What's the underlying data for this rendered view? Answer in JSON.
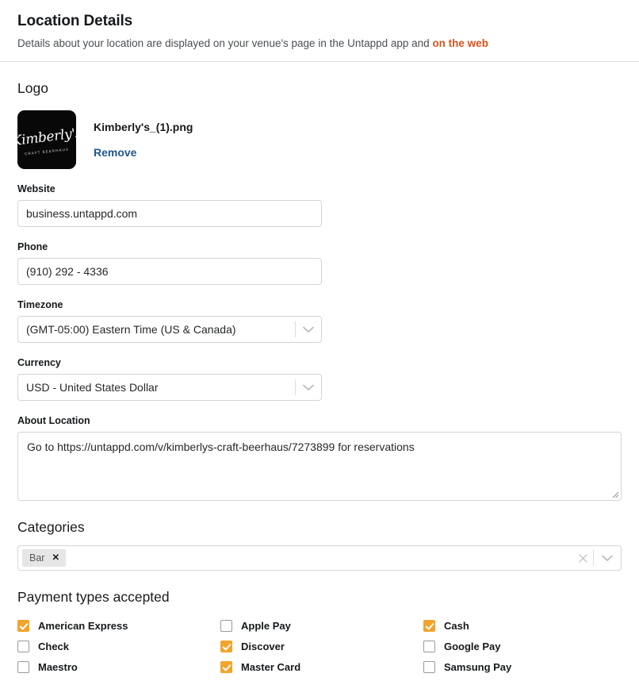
{
  "header": {
    "title": "Location Details",
    "subtitle_prefix": "Details about your location are displayed on your venue's page in the Untappd app and ",
    "link_text": "on the web"
  },
  "logo": {
    "heading": "Logo",
    "mark_script": "Kimberly's",
    "mark_sub": "CRAFT BEERHAUS",
    "filename": "Kimberly's_(1).png",
    "remove_label": "Remove"
  },
  "fields": {
    "website": {
      "label": "Website",
      "value": "business.untappd.com",
      "placeholder": "Website"
    },
    "phone": {
      "label": "Phone",
      "value": "(910) 292 - 4336",
      "placeholder": "Phone"
    },
    "timezone": {
      "label": "Timezone",
      "value": "(GMT-05:00) Eastern Time (US & Canada)"
    },
    "currency": {
      "label": "Currency",
      "value": "USD - United States Dollar"
    },
    "about": {
      "label": "About Location",
      "value": "Go to https://untappd.com/v/kimberlys-craft-beerhaus/7273899 for reservations",
      "placeholder": "About Location"
    }
  },
  "categories": {
    "heading": "Categories",
    "tags": [
      {
        "label": "Bar",
        "remove": "✕"
      }
    ],
    "clear_icon": "✕"
  },
  "payments": {
    "heading": "Payment types accepted",
    "items": [
      {
        "label": "American Express",
        "checked": true
      },
      {
        "label": "Apple Pay",
        "checked": false
      },
      {
        "label": "Cash",
        "checked": true
      },
      {
        "label": "Check",
        "checked": false
      },
      {
        "label": "Discover",
        "checked": true
      },
      {
        "label": "Google Pay",
        "checked": false
      },
      {
        "label": "Maestro",
        "checked": false
      },
      {
        "label": "Master Card",
        "checked": true
      },
      {
        "label": "Samsung Pay",
        "checked": false
      }
    ]
  },
  "colors": {
    "link_orange": "#d9531e",
    "link_blue": "#21578f",
    "checkbox_checked": "#f2a42c",
    "border": "#d5d5d5"
  }
}
